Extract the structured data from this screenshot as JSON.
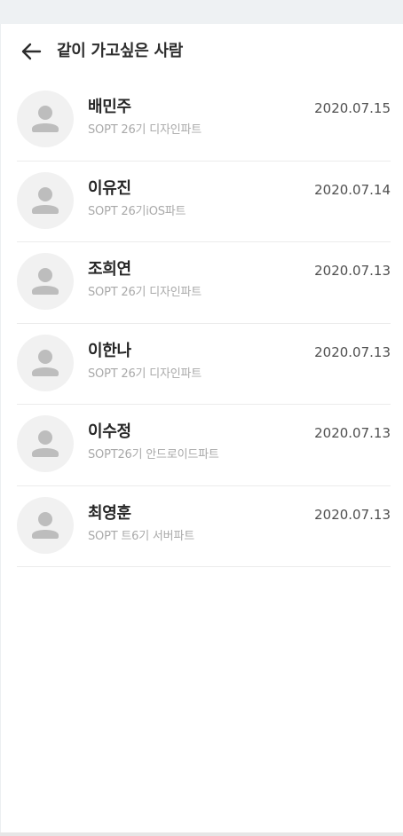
{
  "header": {
    "title": "같이 가고싶은 사람",
    "back_icon": "arrow-left-icon"
  },
  "people": [
    {
      "name": "배민주",
      "info": "SOPT 26기 디자인파트",
      "date": "2020.07.15"
    },
    {
      "name": "이유진",
      "info": "SOPT 26기iOS파트",
      "date": "2020.07.14"
    },
    {
      "name": "조희연",
      "info": "SOPT 26기 디자인파트",
      "date": "2020.07.13"
    },
    {
      "name": "이한나",
      "info": "SOPT 26기 디자인파트",
      "date": "2020.07.13"
    },
    {
      "name": "이수정",
      "info": "SOPT26기 안드로이드파트",
      "date": "2020.07.13"
    },
    {
      "name": "최영훈",
      "info": "SOPT 트6기 서버파트",
      "date": "2020.07.13"
    }
  ],
  "colors": {
    "avatar_bg": "#f1f1f1",
    "avatar_fg": "#bdbdbd",
    "divider": "#ececec"
  }
}
